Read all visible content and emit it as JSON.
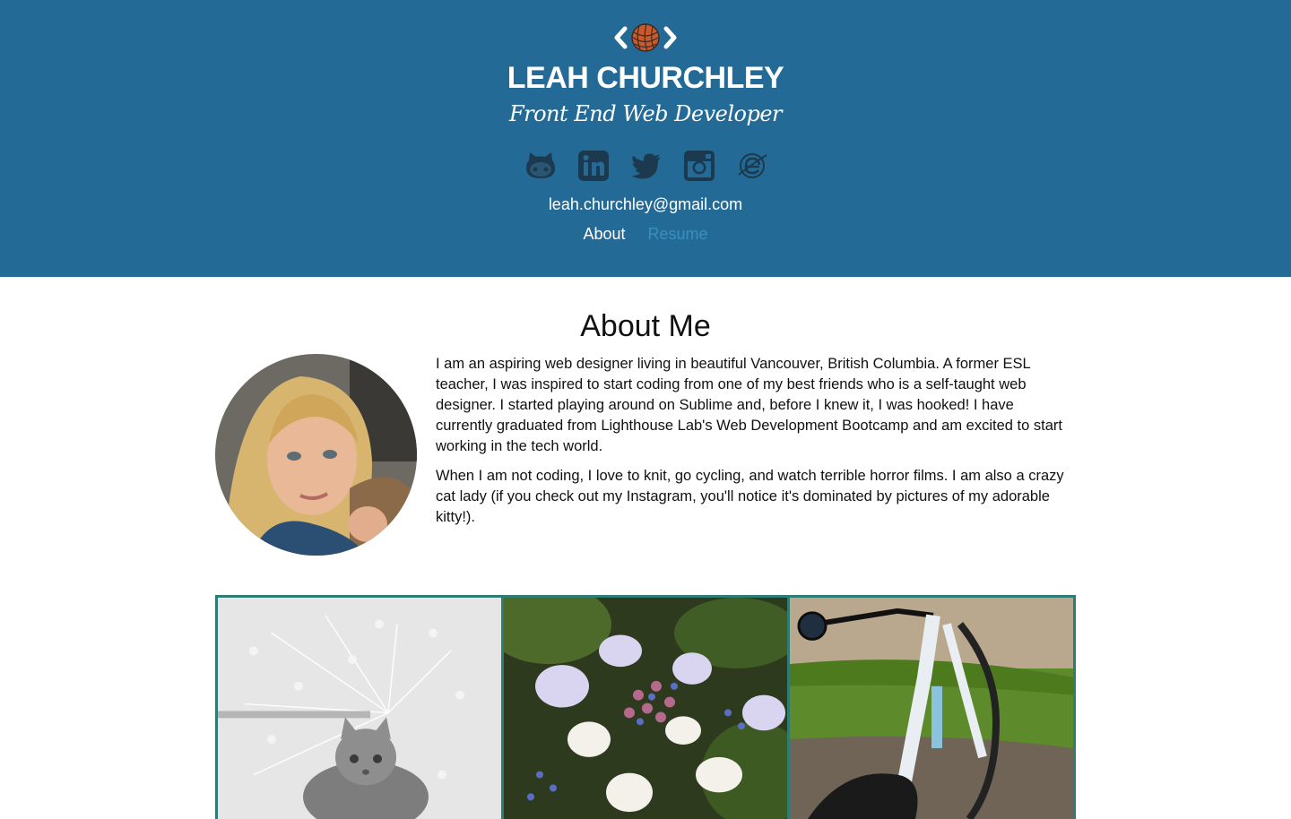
{
  "header": {
    "name": "LEAH CHURCHLEY",
    "tagline": "Front End Web Developer",
    "email": "leah.churchley@gmail.com",
    "logo_icon": "yarn-ball-code-brackets-icon",
    "socials": [
      {
        "name": "github",
        "icon": "github-icon"
      },
      {
        "name": "linkedin",
        "icon": "linkedin-icon"
      },
      {
        "name": "twitter",
        "icon": "twitter-icon"
      },
      {
        "name": "instagram",
        "icon": "instagram-icon"
      },
      {
        "name": "blog",
        "icon": "e-globe-icon"
      }
    ],
    "nav": {
      "about": "About",
      "resume": "Resume"
    }
  },
  "about": {
    "title": "About Me",
    "paragraph_1": "I am an aspiring web designer living in beautiful Vancouver, British Columbia. A former ESL teacher, I was inspired to start coding from one of my best friends who is a self-taught web designer. I started playing around on Sublime and, before I knew it, I was hooked! I have currently graduated from Lighthouse Lab's Web Development Bootcamp and am excited to start working in the tech world.",
    "paragraph_2": "When I am not coding, I love to knit, go cycling, and watch terrible horror films. I am also a crazy cat lady (if you check out my Instagram, you'll notice it's dominated by pictures of my adorable kitty!)."
  },
  "gallery": {
    "photos": [
      "cat-under-umbrella",
      "hydrangea-flowers",
      "bicycle-on-grass"
    ]
  },
  "colors": {
    "header_bg": "#246a96",
    "nav_inactive": "#3a8fbd",
    "gallery_border": "#2e7d74"
  }
}
